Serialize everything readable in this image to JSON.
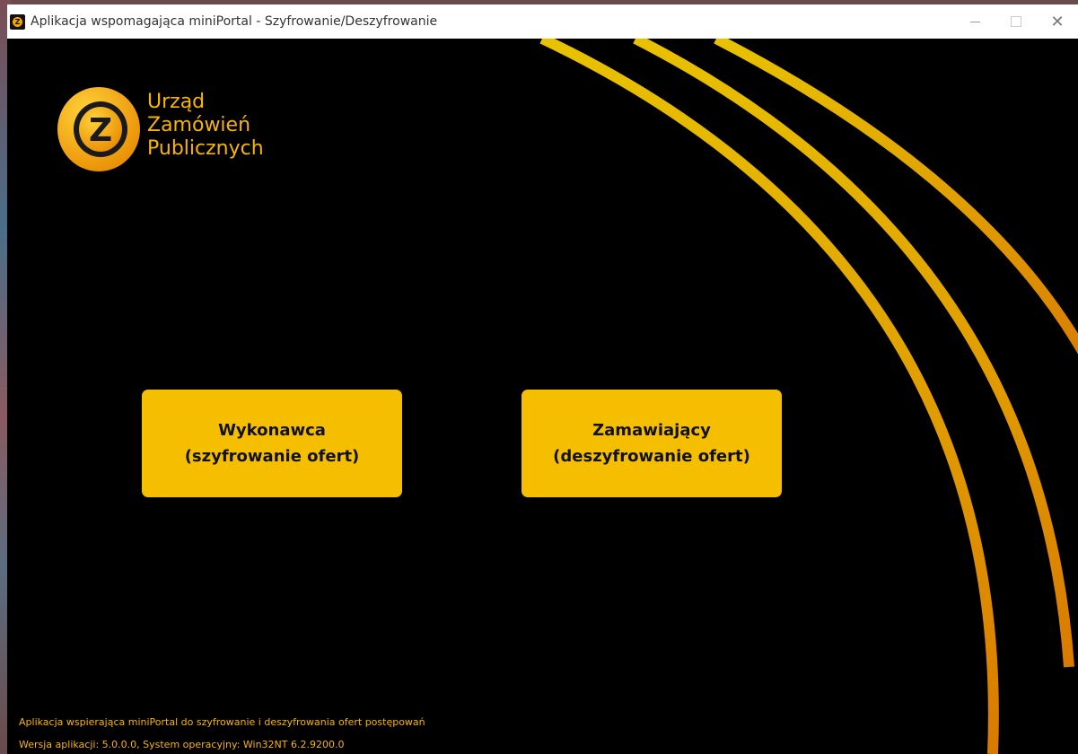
{
  "window": {
    "title": "Aplikacja wspomagająca miniPortal - Szyfrowanie/Deszyfrowanie",
    "icon": "z-app-icon",
    "controls": {
      "minimize": "minimize-icon",
      "maximize": "maximize-icon",
      "close": "close-icon"
    }
  },
  "logo": {
    "text": "Urząd\nZamówień\nPublicznych",
    "mark_letter": "Z"
  },
  "buttons": {
    "wykonawca": "Wykonawca\n(szyfrowanie ofert)",
    "zamawiajacy": "Zamawiający\n(deszyfrowanie ofert)"
  },
  "footer": {
    "description": "Aplikacja wspierająca miniPortal do szyfrowanie i deszyfrowania ofert postępowań",
    "version": "Wersja aplikacji: 5.0.0.0, System operacyjny: Win32NT  6.2.9200.0"
  },
  "colors": {
    "accent": "#f5bf00",
    "background": "#000000",
    "text_accent": "#f7b500",
    "arc_start": "#e8c200",
    "arc_end": "#d97a00"
  }
}
